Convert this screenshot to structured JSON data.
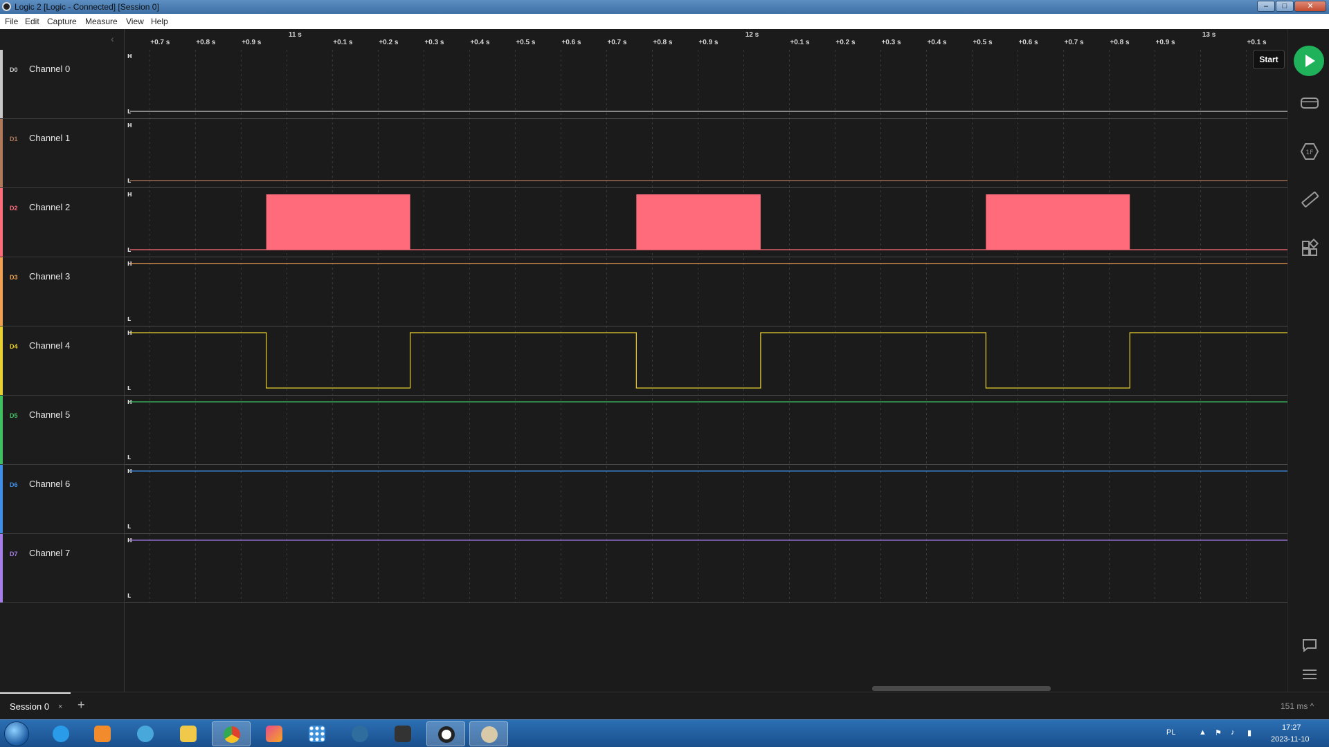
{
  "window": {
    "title": "Logic 2 [Logic - Connected] [Session 0]"
  },
  "menu": [
    "File",
    "Edit",
    "Capture",
    "Measure",
    "View",
    "Help"
  ],
  "channels": [
    {
      "tag": "D0",
      "name": "Channel 0",
      "color": "#c8c8c8"
    },
    {
      "tag": "D1",
      "name": "Channel 1",
      "color": "#b07a5a"
    },
    {
      "tag": "D2",
      "name": "Channel 2",
      "color": "#ff6b7a"
    },
    {
      "tag": "D3",
      "name": "Channel 3",
      "color": "#f0a050"
    },
    {
      "tag": "D4",
      "name": "Channel 4",
      "color": "#e8d030"
    },
    {
      "tag": "D5",
      "name": "Channel 5",
      "color": "#3ec060"
    },
    {
      "tag": "D6",
      "name": "Channel 6",
      "color": "#3f8fe8"
    },
    {
      "tag": "D7",
      "name": "Channel 7",
      "color": "#a77ee8"
    }
  ],
  "level_labels": {
    "high": "H",
    "low": "L"
  },
  "timeline": {
    "start_s": 10.645,
    "end_s": 13.19,
    "tick_labels": [
      {
        "t": 10.7,
        "label": "+0.7 s"
      },
      {
        "t": 10.8,
        "label": "+0.8 s"
      },
      {
        "t": 10.9,
        "label": "+0.9 s"
      },
      {
        "t": 11.1,
        "label": "+0.1 s"
      },
      {
        "t": 11.2,
        "label": "+0.2 s"
      },
      {
        "t": 11.3,
        "label": "+0.3 s"
      },
      {
        "t": 11.4,
        "label": "+0.4 s"
      },
      {
        "t": 11.5,
        "label": "+0.5 s"
      },
      {
        "t": 11.6,
        "label": "+0.6 s"
      },
      {
        "t": 11.7,
        "label": "+0.7 s"
      },
      {
        "t": 11.8,
        "label": "+0.8 s"
      },
      {
        "t": 11.9,
        "label": "+0.9 s"
      },
      {
        "t": 12.1,
        "label": "+0.1 s"
      },
      {
        "t": 12.2,
        "label": "+0.2 s"
      },
      {
        "t": 12.3,
        "label": "+0.3 s"
      },
      {
        "t": 12.4,
        "label": "+0.4 s"
      },
      {
        "t": 12.5,
        "label": "+0.5 s"
      },
      {
        "t": 12.6,
        "label": "+0.6 s"
      },
      {
        "t": 12.7,
        "label": "+0.7 s"
      },
      {
        "t": 12.8,
        "label": "+0.8 s"
      },
      {
        "t": 12.9,
        "label": "+0.9 s"
      },
      {
        "t": 13.1,
        "label": "+0.1 s"
      }
    ],
    "major_labels": [
      {
        "t": 11.0,
        "label": "11 s"
      },
      {
        "t": 12.0,
        "label": "12 s"
      },
      {
        "t": 13.0,
        "label": "13 s"
      }
    ]
  },
  "signals": {
    "D0": {
      "level": "low"
    },
    "D1": {
      "level": "low"
    },
    "D2": {
      "level": "low",
      "activity_bursts_s": [
        [
          10.955,
          11.27
        ],
        [
          11.765,
          12.037
        ],
        [
          12.53,
          12.845
        ]
      ]
    },
    "D3": {
      "level": "high"
    },
    "D4": {
      "level": "high",
      "low_intervals_s": [
        [
          10.955,
          11.27
        ],
        [
          11.765,
          12.037
        ],
        [
          12.53,
          12.845
        ]
      ]
    },
    "D5": {
      "level": "high"
    },
    "D6": {
      "level": "high"
    },
    "D7": {
      "level": "high"
    }
  },
  "toolbar": {
    "start_label": "Start"
  },
  "session": {
    "tab_label": "Session 0",
    "close_glyph": "×",
    "add_glyph": "+",
    "zoom": "151 ms ^"
  },
  "taskbar": {
    "lang": "PL",
    "time": "17:27",
    "date": "2023-11-10"
  }
}
